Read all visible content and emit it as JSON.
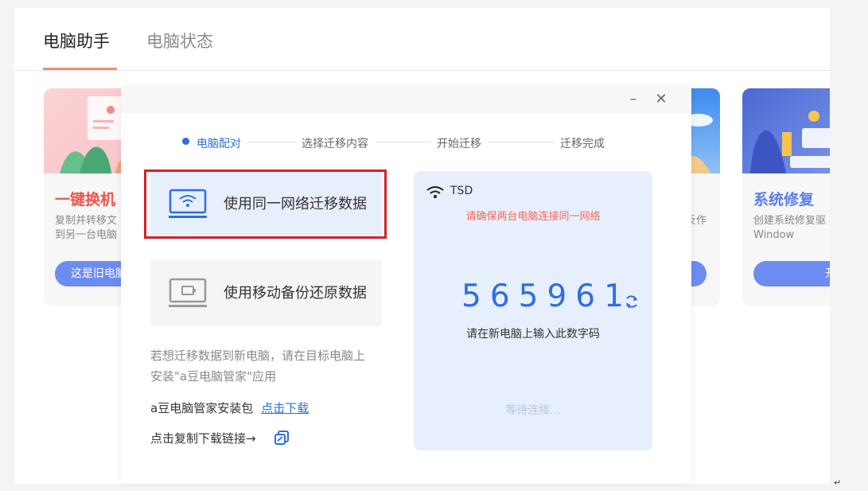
{
  "tabs": [
    {
      "label": "电脑助手",
      "active": true
    },
    {
      "label": "电脑状态",
      "active": false
    }
  ],
  "cards": {
    "left": {
      "title": "一键换机",
      "desc_line1": "复制并转移文",
      "desc_line2": "到另一台电脑",
      "button": "这是旧电脑"
    },
    "right": {
      "title": "系统修复",
      "desc_line1": "创建系统修复驱",
      "desc_line2": "Window",
      "button": "开"
    },
    "middle_partial": {
      "desc": "反作"
    }
  },
  "dialog": {
    "minimize_icon": "minimize-icon",
    "close_icon": "close-icon",
    "steps": [
      {
        "label": "电脑配对",
        "active": true
      },
      {
        "label": "选择迁移内容",
        "active": false
      },
      {
        "label": "开始迁移",
        "active": false
      },
      {
        "label": "迁移完成",
        "active": false
      }
    ],
    "option_network": "使用同一网络迁移数据",
    "option_backup": "使用移动备份还原数据",
    "note_line1": "若想迁移数据到新电脑，请在目标电脑上",
    "note_line2": "安装\"a豆电脑管家\"应用",
    "package_label": "a豆电脑管家安装包",
    "download_link": "点击下载",
    "copy_link": "点击复制下载链接→",
    "panel": {
      "wifi_name": "TSD",
      "warning": "请确保两台电脑连接同一网络",
      "code": "565961",
      "code_hint": "请在新电脑上输入此数字码",
      "waiting": "等待连接..."
    }
  },
  "colors": {
    "accent": "#2f6ee0",
    "highlight_border": "#d2232a",
    "warning_text": "#f06b5b",
    "card_title_left": "#f0564a",
    "card_title_right": "#5b7ee8",
    "tab_underline": "#f28b78"
  }
}
